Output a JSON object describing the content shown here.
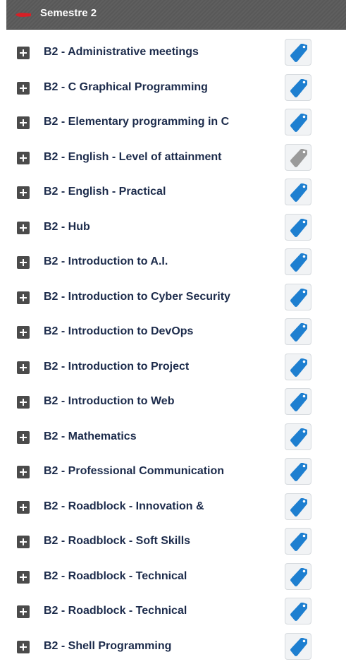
{
  "header": {
    "title": "Semestre 2",
    "arrow_icon": "collapse-arrow-icon",
    "arrow_color": "#d81f26"
  },
  "modules": [
    {
      "label": "B2 - Administrative meetings",
      "tag_state": "active"
    },
    {
      "label": "B2 - C Graphical Programming",
      "tag_state": "active"
    },
    {
      "label": "B2 - Elementary programming in C",
      "tag_state": "active"
    },
    {
      "label": "B2 - English - Level of attainment",
      "tag_state": "inactive"
    },
    {
      "label": "B2 - English - Practical",
      "tag_state": "active"
    },
    {
      "label": "B2 - Hub",
      "tag_state": "active"
    },
    {
      "label": "B2 - Introduction to A.I.",
      "tag_state": "active"
    },
    {
      "label": "B2 - Introduction to Cyber Security",
      "tag_state": "active"
    },
    {
      "label": "B2 - Introduction to DevOps",
      "tag_state": "active"
    },
    {
      "label": "B2 - Introduction to Project",
      "tag_state": "active"
    },
    {
      "label": "B2 - Introduction to Web",
      "tag_state": "active"
    },
    {
      "label": "B2 - Mathematics",
      "tag_state": "active"
    },
    {
      "label": "B2 - Professional Communication",
      "tag_state": "active"
    },
    {
      "label": "B2 - Roadblock - Innovation &",
      "tag_state": "active"
    },
    {
      "label": "B2 - Roadblock - Soft Skills",
      "tag_state": "active"
    },
    {
      "label": "B2 - Roadblock - Technical",
      "tag_state": "active"
    },
    {
      "label": "B2 - Roadblock - Technical",
      "tag_state": "active"
    },
    {
      "label": "B2 - Shell Programming",
      "tag_state": "active"
    }
  ],
  "icons": {
    "expand": "plus-icon",
    "tag": "tag-icon"
  },
  "colors": {
    "tag_active": "#1e7fd0",
    "tag_inactive": "#9a9a9a",
    "label_text": "#1c2b4b",
    "header_bg": "#5c5c5c"
  }
}
